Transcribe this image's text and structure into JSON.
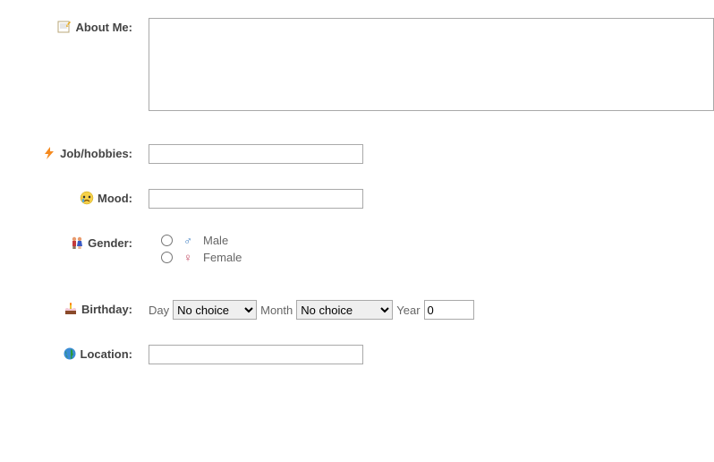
{
  "fields": {
    "about": {
      "label": "About Me:",
      "value": ""
    },
    "job": {
      "label": "Job/hobbies:",
      "value": ""
    },
    "mood": {
      "label": "Mood:",
      "value": ""
    },
    "gender": {
      "label": "Gender:",
      "options": {
        "male": "Male",
        "female": "Female"
      }
    },
    "birthday": {
      "label": "Birthday:",
      "day_label": "Day",
      "day_value": "No choice",
      "month_label": "Month",
      "month_value": "No choice",
      "year_label": "Year",
      "year_value": "0"
    },
    "location": {
      "label": "Location:",
      "value": ""
    }
  }
}
